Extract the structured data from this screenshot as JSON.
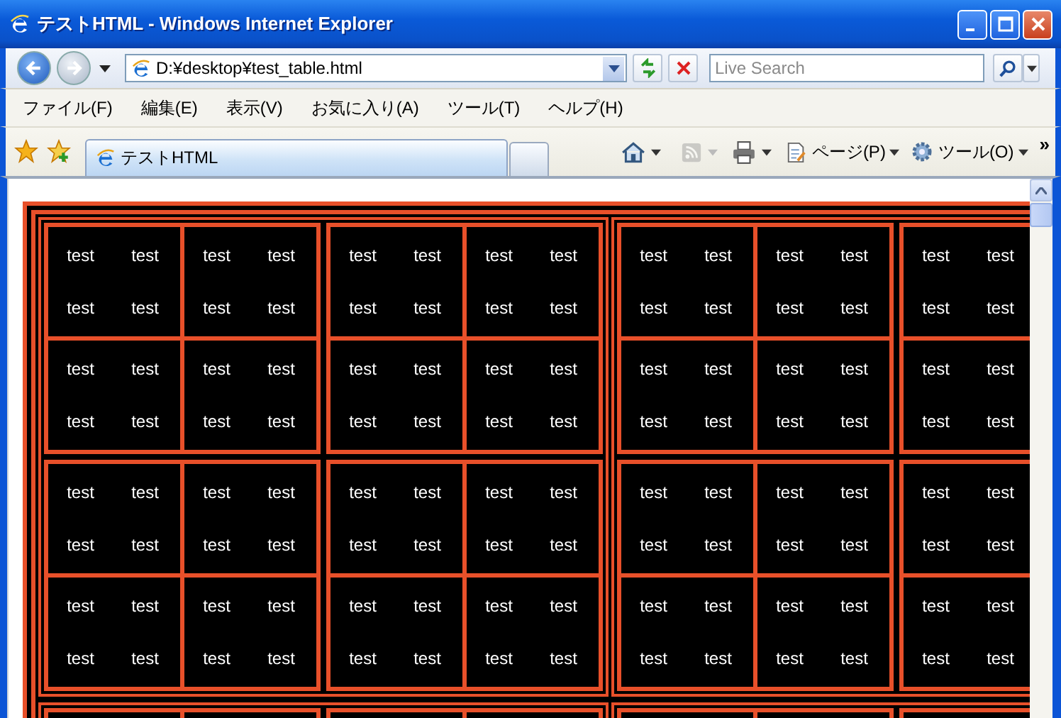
{
  "window": {
    "title": "テストHTML - Windows Internet Explorer"
  },
  "address_bar": {
    "url": "D:¥desktop¥test_table.html"
  },
  "search": {
    "placeholder": "Live Search"
  },
  "menu": [
    "ファイル(F)",
    "編集(E)",
    "表示(V)",
    "お気に入り(A)",
    "ツール(T)",
    "ヘルプ(H)"
  ],
  "tabs": [
    {
      "label": "テストHTML",
      "selected": true
    }
  ],
  "command_bar": {
    "feeds": {
      "disabled": true
    },
    "page_menu": "ページ(P)",
    "tools_menu": "ツール(O)",
    "more": "»"
  },
  "page": {
    "rows": [
      [
        "test",
        "test",
        "test",
        "test",
        "test",
        "test",
        "test",
        "test",
        "test",
        "test",
        "test",
        "test",
        "test",
        "test"
      ],
      [
        "test",
        "test",
        "test",
        "test",
        "test",
        "test",
        "test",
        "test",
        "test",
        "test",
        "test",
        "test",
        "test",
        "test"
      ],
      [
        "test",
        "test",
        "test",
        "test",
        "test",
        "test",
        "test",
        "test",
        "test",
        "test",
        "test",
        "test",
        "test",
        "test"
      ],
      [
        "test",
        "test",
        "test",
        "test",
        "test",
        "test",
        "test",
        "test",
        "test",
        "test",
        "test",
        "test",
        "test",
        "test"
      ],
      [
        "test",
        "test",
        "test",
        "test",
        "test",
        "test",
        "test",
        "test",
        "test",
        "test",
        "test",
        "test",
        "test",
        "test"
      ],
      [
        "test",
        "test",
        "test",
        "test",
        "test",
        "test",
        "test",
        "test",
        "test",
        "test",
        "test",
        "test",
        "test",
        "test"
      ],
      [
        "test",
        "test",
        "test",
        "test",
        "test",
        "test",
        "test",
        "test",
        "test",
        "test",
        "test",
        "test",
        "test",
        "test"
      ],
      [
        "test",
        "test",
        "test",
        "test",
        "test",
        "test",
        "test",
        "test",
        "test",
        "test",
        "test",
        "test",
        "test",
        "test"
      ]
    ]
  }
}
